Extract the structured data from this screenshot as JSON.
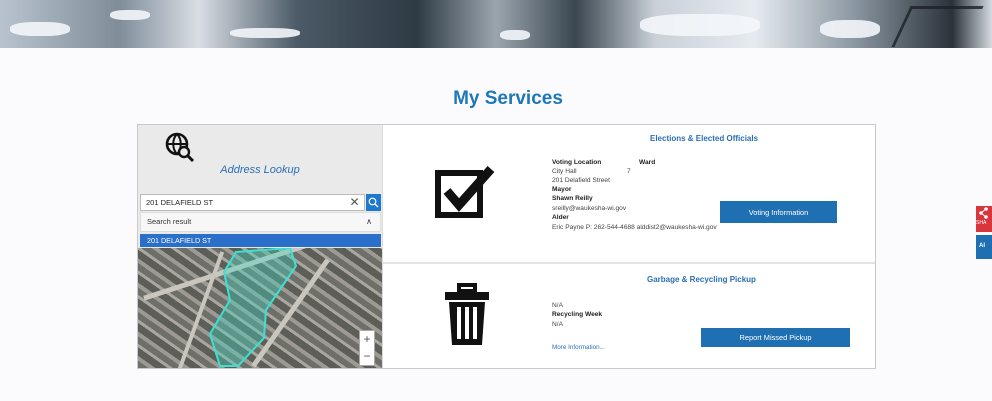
{
  "page": {
    "title": "My Services"
  },
  "lookup": {
    "title": "Address Lookup",
    "search_value": "201 DELAFIELD ST",
    "clear_glyph": "✕",
    "results_header": "Search result",
    "chevron": "∧",
    "result_item": "201 DELAFIELD ST",
    "zoom_in": "+",
    "zoom_out": "−"
  },
  "elections": {
    "title": "Elections & Elected Officials",
    "voting_location_label": "Voting Location",
    "ward_label": "Ward",
    "voting_location_line1": "City Hall",
    "ward_value": "7",
    "voting_location_line2": "201 Delafield Street",
    "mayor_label": "Mayor",
    "mayor_name": "Shawn Reilly",
    "mayor_email": "sreilly@waukesha-wi.gov",
    "alder_label": "Alder",
    "alder_info": "Eric Payne    P: 262-544-4688    alddist2@waukesha-wi.gov",
    "button_label": "Voting Information"
  },
  "garbage": {
    "title": "Garbage & Recycling Pickup",
    "value1": "N/A",
    "recycling_week_label": "Recycling Week",
    "recycling_week_value": "N/A",
    "more_link": "More Information...",
    "button_label": "Report Missed Pickup"
  },
  "side": {
    "share_label": "SHA",
    "accessibility_label": "AI"
  },
  "colors": {
    "accent": "#1e78b8",
    "button": "#1f6fb3",
    "selected": "#2a6fc9",
    "share": "#d8353c"
  },
  "icons": [
    "globe-search-icon",
    "clear-icon",
    "search-icon",
    "chevron-up-icon",
    "checkbox-icon",
    "trash-icon",
    "share-icon"
  ]
}
